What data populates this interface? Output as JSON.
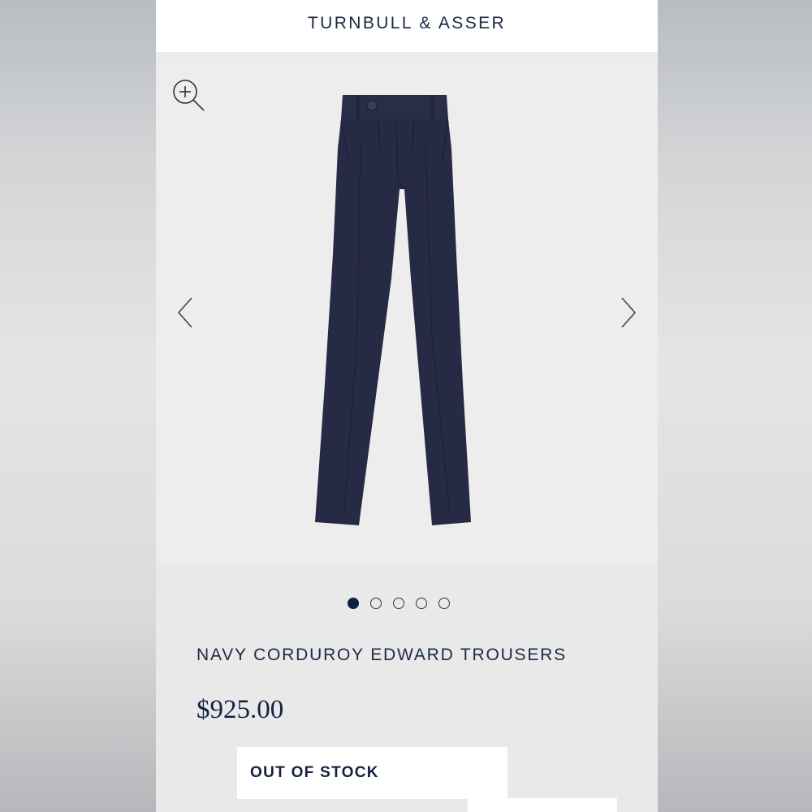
{
  "header": {
    "brand": "TURNBULL & ASSER"
  },
  "gallery": {
    "zoom_icon": "zoom-in-icon",
    "prev_icon": "chevron-left-icon",
    "next_icon": "chevron-right-icon",
    "product_color": "#262a45",
    "slides_total": 5,
    "active_slide": 1
  },
  "product": {
    "name": "NAVY CORDUROY EDWARD TROUSERS",
    "price": "$925.00",
    "stock_status": "OUT OF STOCK"
  },
  "colors": {
    "brand_navy": "#1a2942",
    "page_bg": "#ececec",
    "header_bg": "#ffffff"
  }
}
